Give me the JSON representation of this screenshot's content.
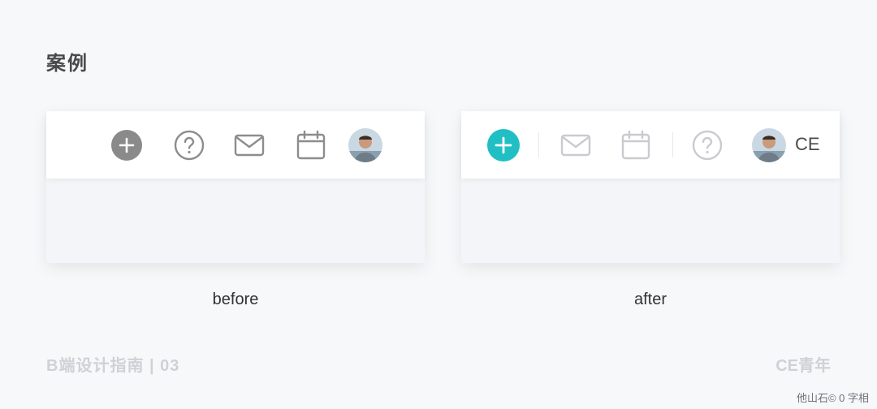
{
  "page": {
    "title": "案例",
    "footer_left": "B端设计指南 | 03",
    "footer_right": "CE青年",
    "watermark": "他山石© 0 字相"
  },
  "before": {
    "caption": "before",
    "icons": [
      "add-circle-icon",
      "help-circle-icon",
      "mail-icon",
      "calendar-icon",
      "avatar"
    ],
    "colors": {
      "add": "#8a8a8a",
      "outline": "#8d8d8d"
    }
  },
  "after": {
    "caption": "after",
    "icons": [
      "add-circle-icon",
      "mail-icon",
      "calendar-icon",
      "help-circle-icon",
      "avatar"
    ],
    "user_initials": "CE",
    "colors": {
      "add": "#1fbfc4",
      "outline": "#c9cbd0"
    }
  }
}
